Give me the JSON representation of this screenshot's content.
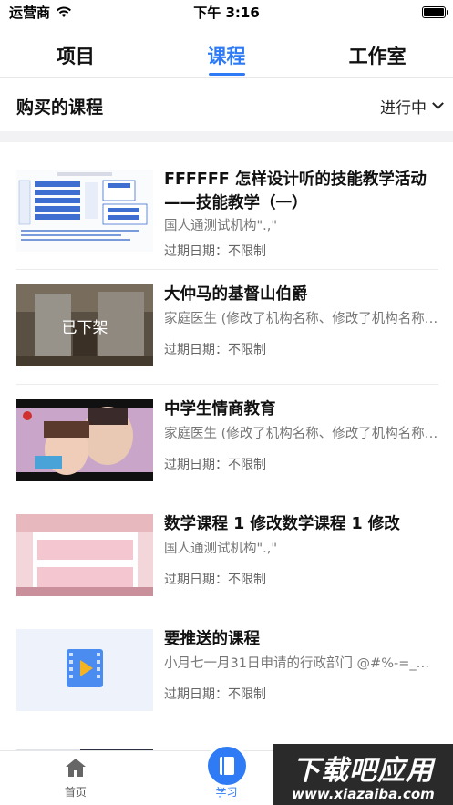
{
  "status_bar": {
    "carrier": "运营商",
    "time": "下午 3:16"
  },
  "top_tabs": [
    {
      "label": "项目",
      "active": false
    },
    {
      "label": "课程",
      "active": true
    },
    {
      "label": "工作室",
      "active": false
    }
  ],
  "section": {
    "title": "购买的课程",
    "filter": "进行中"
  },
  "courses": [
    {
      "title": "FFFFFF 怎样设计听的技能教学活动——技能教学（一）",
      "org": "国人通测试机构\".,\"",
      "expire": "过期日期：不限制"
    },
    {
      "title": "大仲马的基督山伯爵",
      "org": "家庭医生 (修改了机构名称、修改了机构名称…",
      "expire": "过期日期：不限制",
      "badge": "已下架"
    },
    {
      "title": "中学生情商教育",
      "org": "家庭医生 (修改了机构名称、修改了机构名称…",
      "expire": "过期日期：不限制"
    },
    {
      "title": "数学课程 1 修改数学课程 1 修改",
      "org": "国人通测试机构\".,\"",
      "expire": "过期日期：不限制"
    },
    {
      "title": "要推送的课程",
      "org": "小月七一月31日申请的行政部门 @#%-=_~[];…",
      "expire": "过期日期：不限制"
    }
  ],
  "bottom_nav": {
    "home": "首页",
    "study": "学习"
  },
  "watermark": {
    "main": "下载吧应用",
    "sub": "www.xiazaiba.com"
  },
  "colors": {
    "accent": "#2f7bf5"
  }
}
